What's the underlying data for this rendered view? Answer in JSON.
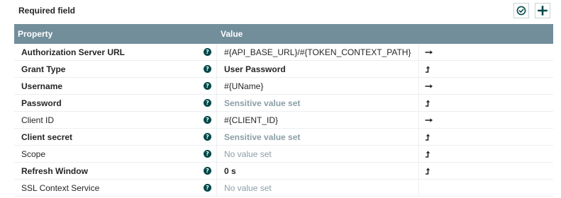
{
  "toolbar": {
    "required_label": "Required field",
    "verify_icon": "check-circle-icon",
    "add_icon": "plus-icon"
  },
  "table": {
    "columns": {
      "property": "Property",
      "value": "Value"
    },
    "rows": [
      {
        "property": "Authorization Server URL",
        "property_weight": "bold",
        "value": "#{API_BASE_URL}/#{TOKEN_CONTEXT_PATH}",
        "value_state": "set",
        "action": "goto-icon"
      },
      {
        "property": "Grant Type",
        "property_weight": "bold",
        "value": "User Password",
        "value_state": "set-bold",
        "action": "upload-icon"
      },
      {
        "property": "Username",
        "property_weight": "bold",
        "value": "#{UName}",
        "value_state": "set",
        "action": "goto-icon"
      },
      {
        "property": "Password",
        "property_weight": "bold",
        "value": "Sensitive value set",
        "value_state": "sensitive",
        "action": "upload-icon"
      },
      {
        "property": "Client ID",
        "property_weight": "normal",
        "value": "#{CLIENT_ID}",
        "value_state": "set",
        "action": "goto-icon"
      },
      {
        "property": "Client secret",
        "property_weight": "bold",
        "value": "Sensitive value set",
        "value_state": "sensitive",
        "action": "upload-icon"
      },
      {
        "property": "Scope",
        "property_weight": "normal",
        "value": "No value set",
        "value_state": "novalue",
        "action": "upload-icon"
      },
      {
        "property": "Refresh Window",
        "property_weight": "bold",
        "value": "0 s",
        "value_state": "set-bold",
        "action": "upload-icon"
      },
      {
        "property": "SSL Context Service",
        "property_weight": "normal",
        "value": "No value set",
        "value_state": "novalue",
        "action": ""
      }
    ],
    "help_glyph": "?",
    "help_icon": "question-circle-icon"
  },
  "colors": {
    "header_bg": "#728e9b",
    "help_icon": "#004849",
    "muted_text": "#8b9ea6"
  }
}
